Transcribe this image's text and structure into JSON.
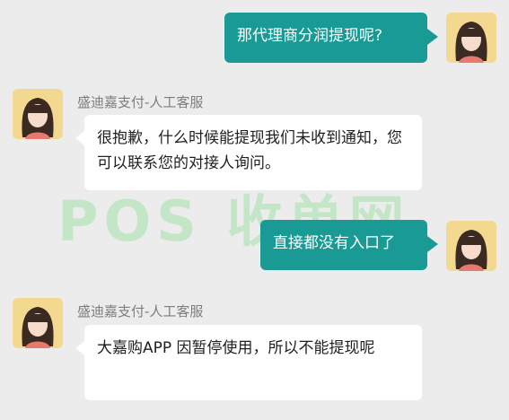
{
  "messages": [
    {
      "side": "right",
      "text": "那代理商分润提现呢?"
    },
    {
      "side": "left",
      "sender": "盛迪嘉支付-人工客服",
      "text": "很抱歉，什么时候能提现我们未收到通知，您可以联系您的对接人询问。"
    },
    {
      "side": "right",
      "text": "直接都没有入口了"
    },
    {
      "side": "left",
      "sender": "盛迪嘉支付-人工客服",
      "text": "大嘉购APP 因暂停使用，所以不能提现呢"
    }
  ],
  "watermark": {
    "text": "POS 收单网"
  },
  "colors": {
    "right_bubble": "#1a9a94",
    "background": "#ececec",
    "avatar_bg": "#f3d98f"
  }
}
